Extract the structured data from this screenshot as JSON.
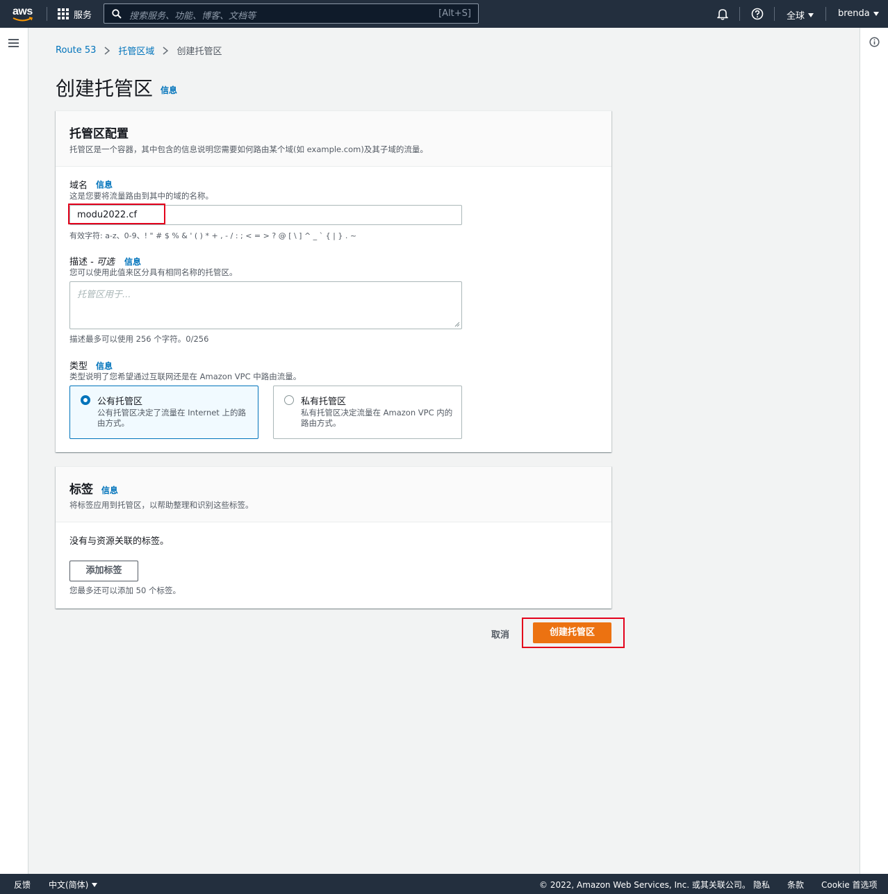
{
  "topnav": {
    "logo_text": "aws",
    "services_label": "服务",
    "search_placeholder": "搜索服务、功能、博客、文档等",
    "search_shortcut": "[Alt+S]",
    "region_label": "全球",
    "user_label": "brenda"
  },
  "breadcrumb": {
    "items": [
      "Route 53",
      "托管区域",
      "创建托管区"
    ]
  },
  "page": {
    "title": "创建托管区",
    "info_label": "信息"
  },
  "config_section": {
    "title": "托管区配置",
    "description": "托管区是一个容器，其中包含的信息说明您需要如何路由某个域(如 example.com)及其子域的流量。",
    "domain": {
      "label": "域名",
      "info_label": "信息",
      "description": "这是您要将流量路由到其中的域的名称。",
      "value": "modu2022.cf",
      "constraint": "有效字符: a-z、0-9、! \" # $ % & ' ( ) * + , - / : ; < = > ? @ [ \\ ] ^ _ ` { | } . ~"
    },
    "description_field": {
      "label": "描述 - ",
      "optional_label": "可选",
      "info_label": "信息",
      "description": "您可以使用此值来区分具有相同名称的托管区。",
      "placeholder": "托管区用于...",
      "constraint": "描述最多可以使用 256 个字符。0/256"
    },
    "type": {
      "label": "类型",
      "info_label": "信息",
      "description": "类型说明了您希望通过互联网还是在 Amazon VPC 中路由流量。",
      "options": [
        {
          "title": "公有托管区",
          "description": "公有托管区决定了流量在 Internet 上的路由方式。",
          "selected": true
        },
        {
          "title": "私有托管区",
          "description": "私有托管区决定流量在 Amazon VPC 内的路由方式。",
          "selected": false
        }
      ]
    }
  },
  "tags_section": {
    "title": "标签",
    "info_label": "信息",
    "description": "将标签应用到托管区，以帮助整理和识别这些标签。",
    "empty_text": "没有与资源关联的标签。",
    "add_button": "添加标签",
    "limit_text": "您最多还可以添加 50 个标签。"
  },
  "actions": {
    "cancel": "取消",
    "create": "创建托管区"
  },
  "footer": {
    "feedback": "反馈",
    "language": "中文(简体)",
    "copyright": "© 2022, Amazon Web Services, Inc. 或其关联公司。",
    "privacy": "隐私",
    "terms": "条款",
    "cookies": "Cookie 首选项"
  },
  "colors": {
    "nav_bg": "#232f3e",
    "link": "#0073bb",
    "primary": "#ec7211",
    "highlight": "#e3001b"
  }
}
